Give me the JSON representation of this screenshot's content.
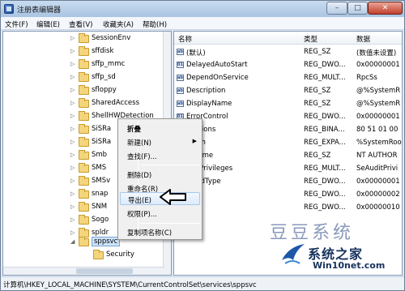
{
  "window": {
    "title": "注册表编辑器",
    "min_label": "–",
    "max_label": "□",
    "close_label": "✕"
  },
  "menu": {
    "items": [
      "文件(F)",
      "编辑(E)",
      "查看(V)",
      "收藏夹(A)",
      "帮助(H)"
    ]
  },
  "tree": {
    "items": [
      "SessionEnv",
      "sffdisk",
      "sffp_mmc",
      "sffp_sd",
      "sfloppy",
      "SharedAccess",
      "ShellHWDetection",
      "SiSRa",
      "SiSRa",
      "Smb",
      "SMS",
      "SMSv",
      "snap",
      "SNM",
      "Sogo",
      "spldr",
      "Spoc",
      "sppsvc",
      "Security"
    ],
    "selected": "sppsvc"
  },
  "list": {
    "headers": {
      "name": "名称",
      "type": "类型",
      "data": "数据"
    },
    "rows": [
      {
        "name": "(默认)",
        "type": "REG_SZ",
        "data": "(数值未设置)",
        "icon": "ab"
      },
      {
        "name": "DelayedAutoStart",
        "type": "REG_DWO...",
        "data": "0x00000001",
        "icon": "01"
      },
      {
        "name": "DependOnService",
        "type": "REG_MULT...",
        "data": "RpcSs",
        "icon": "ab"
      },
      {
        "name": "Description",
        "type": "REG_SZ",
        "data": "@%SystemR",
        "icon": "ab"
      },
      {
        "name": "DisplayName",
        "type": "REG_SZ",
        "data": "@%SystemR",
        "icon": "ab"
      },
      {
        "name": "ErrorControl",
        "type": "REG_DWO...",
        "data": "0x00000001",
        "icon": "01"
      },
      {
        "name": "eActions",
        "type": "REG_BINA...",
        "data": "80 51 01 00",
        "icon": "01"
      },
      {
        "name": "ePath",
        "type": "REG_EXPA...",
        "data": "%SystemRoo",
        "icon": "ab"
      },
      {
        "name": "ctName",
        "type": "REG_SZ",
        "data": "NT AUTHOR",
        "icon": "ab"
      },
      {
        "name": "iredPrivileges",
        "type": "REG_MULT...",
        "data": "SeAuditPrivi",
        "icon": "ab"
      },
      {
        "name": "ceSidType",
        "type": "REG_DWO...",
        "data": "0x00000001",
        "icon": "01"
      },
      {
        "name": "",
        "type": "REG_DWO...",
        "data": "0x00000002",
        "icon": "01"
      },
      {
        "name": "",
        "type": "REG_DWO...",
        "data": "0x00000010",
        "icon": "01"
      }
    ]
  },
  "context_menu": {
    "items": [
      {
        "label": "折叠",
        "bold": true
      },
      {
        "label": "新建(N)",
        "submenu": "▶"
      },
      {
        "label": "查找(F)..."
      },
      {
        "label": "删除(D)"
      },
      {
        "label": "重命名(R)"
      },
      {
        "label": "导出(E)",
        "highlight": true
      },
      {
        "label": "权限(P)..."
      },
      {
        "label": "复制项名称(C)"
      }
    ]
  },
  "status": {
    "path": "计算机\\HKEY_LOCAL_MACHINE\\SYSTEM\\CurrentControlSet\\services\\sppsvc"
  },
  "watermark": {
    "text": "豆豆系统"
  },
  "logo": {
    "title": "系统之家",
    "url": "Win10net.com"
  },
  "colors": {
    "accent": "#1f4e9a",
    "window_bg": "#dfe9f5",
    "selection": "#cde4fb"
  }
}
